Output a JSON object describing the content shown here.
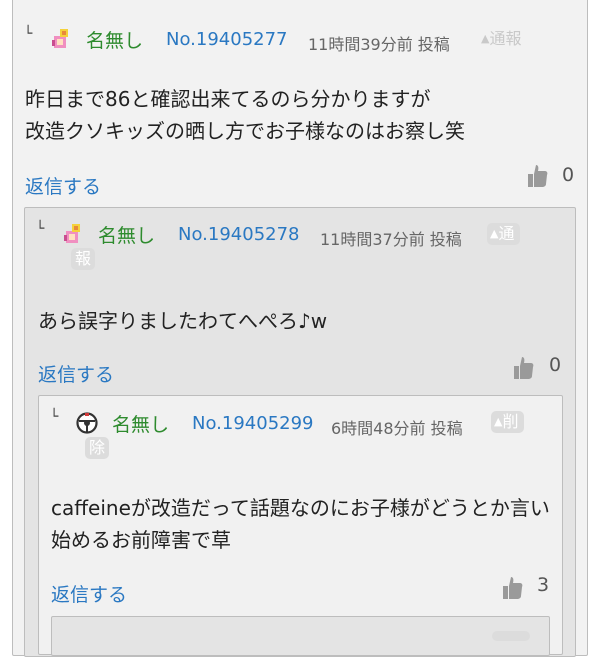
{
  "posts": [
    {
      "corner": "└",
      "name": "名無し",
      "number": "No.19405277",
      "time": "11時間39分前 投稿",
      "action": "通報",
      "body_lines": [
        "昨日まで86と確認出来てるのら分かりますが",
        "改造クソキッズの晒し方でお子様なのはお察し笑"
      ],
      "reply_label": "返信する",
      "likes": "0",
      "avatar_icon": "girl-flower-avatar-icon"
    },
    {
      "corner": "└",
      "name": "名無し",
      "number": "No.19405278",
      "time": "11時間37分前 投稿",
      "action_1": "通",
      "action_2": "報",
      "body_lines": [
        "あら誤字りましたわてへぺろ♪w"
      ],
      "reply_label": "返信する",
      "likes": "0",
      "avatar_icon": "girl-flower-avatar-icon"
    },
    {
      "corner": "└",
      "name": "名無し",
      "number": "No.19405299",
      "time": "6時間48分前 投稿",
      "action_1": "削",
      "action_2": "除",
      "body_lines": [
        "caffeineが改造だって話題なのにお子様がどうとか言い",
        "始めるお前障害で草"
      ],
      "reply_label": "返信する",
      "likes": "3",
      "avatar_icon": "steering-wheel-avatar-icon"
    }
  ],
  "colors": {
    "name": "#2e8b2e",
    "link": "#2a78c2",
    "card_outer": "#f2f2f2",
    "card_nested": "#e4e4e4"
  }
}
